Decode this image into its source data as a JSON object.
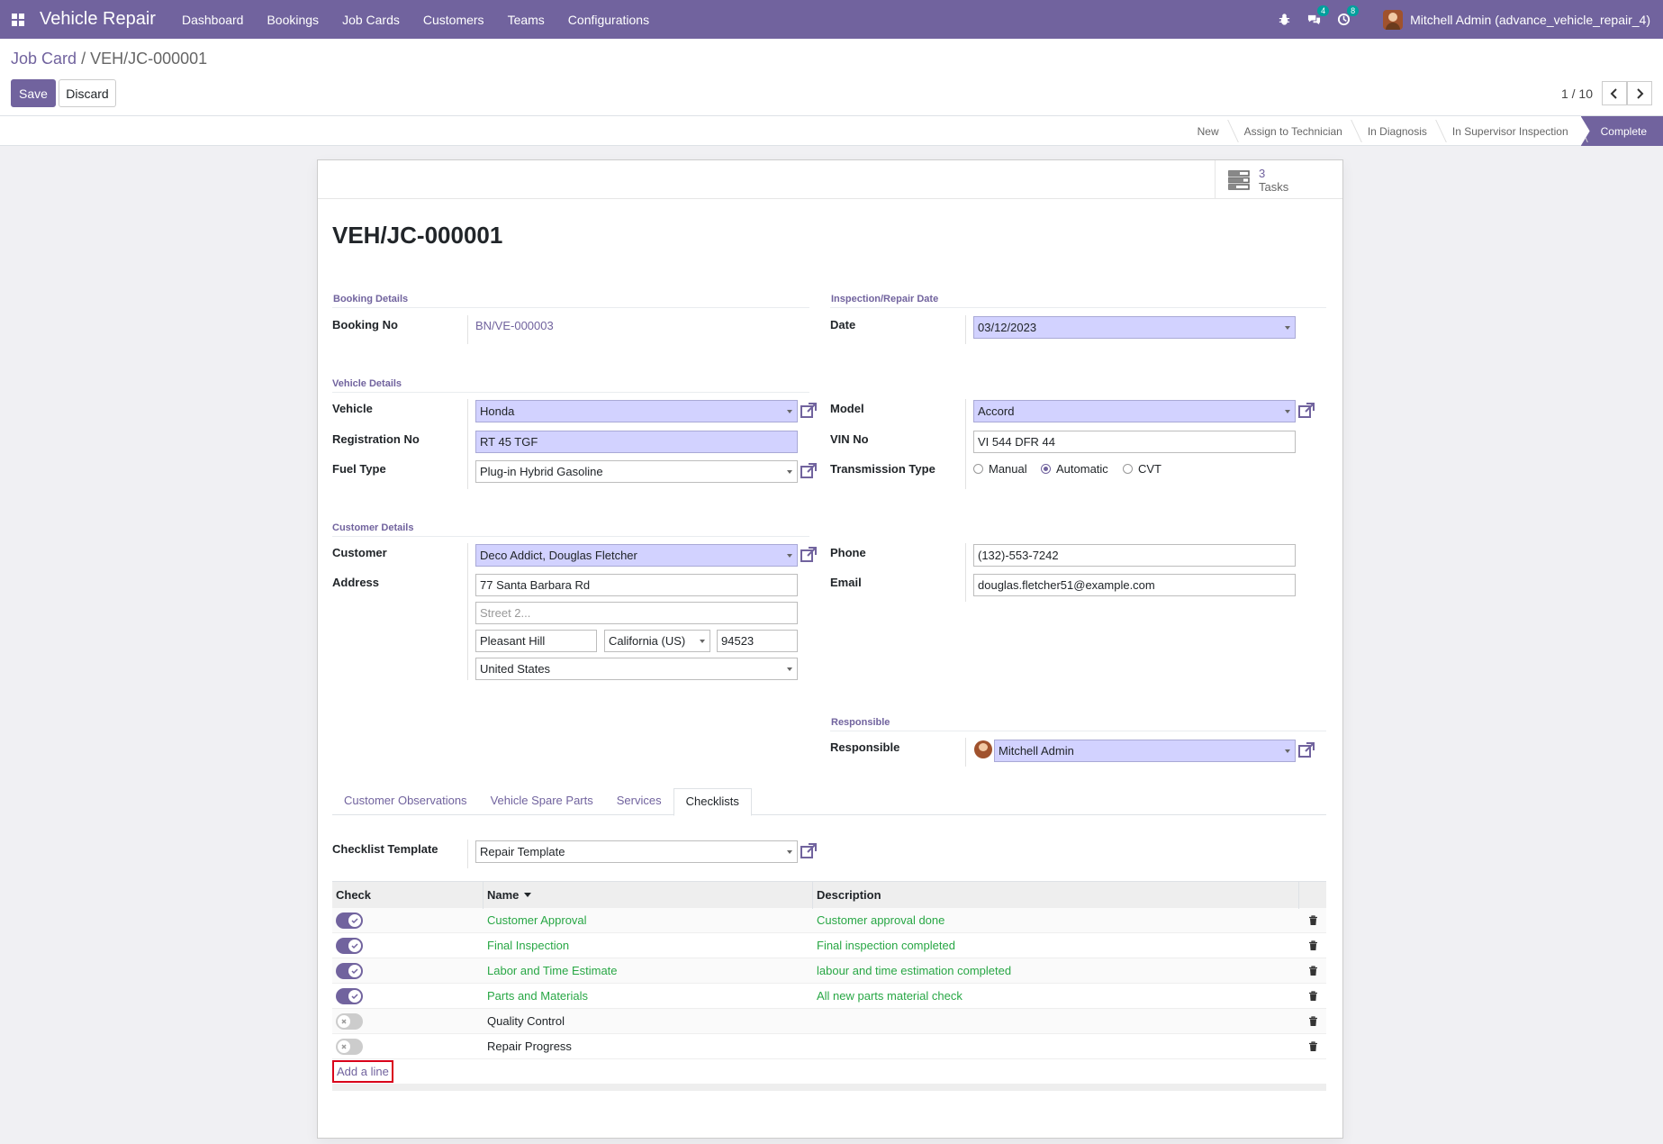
{
  "navbar": {
    "app_name": "Vehicle Repair",
    "menu": [
      "Dashboard",
      "Bookings",
      "Job Cards",
      "Customers",
      "Teams",
      "Configurations"
    ],
    "messages_count": "4",
    "activities_count": "8",
    "user": "Mitchell Admin (advance_vehicle_repair_4)",
    "accent": "#71639e"
  },
  "control": {
    "breadcrumb_parent": "Job Card",
    "breadcrumb_sep": "/",
    "breadcrumb_current": "VEH/JC-000001",
    "save_label": "Save",
    "discard_label": "Discard",
    "pager": "1 / 10"
  },
  "stages": [
    "New",
    "Assign to Technician",
    "In Diagnosis",
    "In Supervisor Inspection",
    "Complete"
  ],
  "smart_button": {
    "count": "3",
    "label": "Tasks"
  },
  "record": {
    "title": "VEH/JC-000001",
    "booking_section": "Booking Details",
    "booking_no_label": "Booking No",
    "booking_no": "BN/VE-000003",
    "inspection_section": "Inspection/Repair Date",
    "date_label": "Date",
    "date": "03/12/2023",
    "vehicle_section": "Vehicle Details",
    "vehicle_label": "Vehicle",
    "vehicle": "Honda",
    "model_label": "Model",
    "model": "Accord",
    "registration_label": "Registration No",
    "registration": "RT 45 TGF",
    "vin_label": "VIN No",
    "vin": "VI 544 DFR 44",
    "fuel_label": "Fuel Type",
    "fuel": "Plug-in Hybrid Gasoline",
    "transmission_label": "Transmission Type",
    "transmission_options": [
      "Manual",
      "Automatic",
      "CVT"
    ],
    "transmission_selected": "Automatic",
    "customer_section": "Customer Details",
    "customer_label": "Customer",
    "customer": "Deco Addict, Douglas Fletcher",
    "phone_label": "Phone",
    "phone": "(132)-553-7242",
    "address_label": "Address",
    "street": "77 Santa Barbara Rd",
    "street2_placeholder": "Street 2...",
    "city": "Pleasant Hill",
    "state": "California (US)",
    "zip": "94523",
    "country": "United States",
    "email_label": "Email",
    "email": "douglas.fletcher51@example.com",
    "responsible_section": "Responsible",
    "responsible_label": "Responsible",
    "responsible": "Mitchell Admin"
  },
  "tabs": [
    "Customer Observations",
    "Vehicle Spare Parts",
    "Services",
    "Checklists"
  ],
  "active_tab": "Checklists",
  "checklist": {
    "template_label": "Checklist Template",
    "template": "Repair Template",
    "columns": [
      "Check",
      "Name",
      "Description"
    ],
    "rows": [
      {
        "checked": true,
        "name": "Customer Approval",
        "description": "Customer approval done"
      },
      {
        "checked": true,
        "name": "Final Inspection",
        "description": "Final inspection completed"
      },
      {
        "checked": true,
        "name": "Labor and Time Estimate",
        "description": "labour and time estimation completed"
      },
      {
        "checked": true,
        "name": "Parts and Materials",
        "description": "All new parts material check"
      },
      {
        "checked": false,
        "name": "Quality Control",
        "description": ""
      },
      {
        "checked": false,
        "name": "Repair Progress",
        "description": ""
      }
    ],
    "add_line": "Add a line"
  }
}
